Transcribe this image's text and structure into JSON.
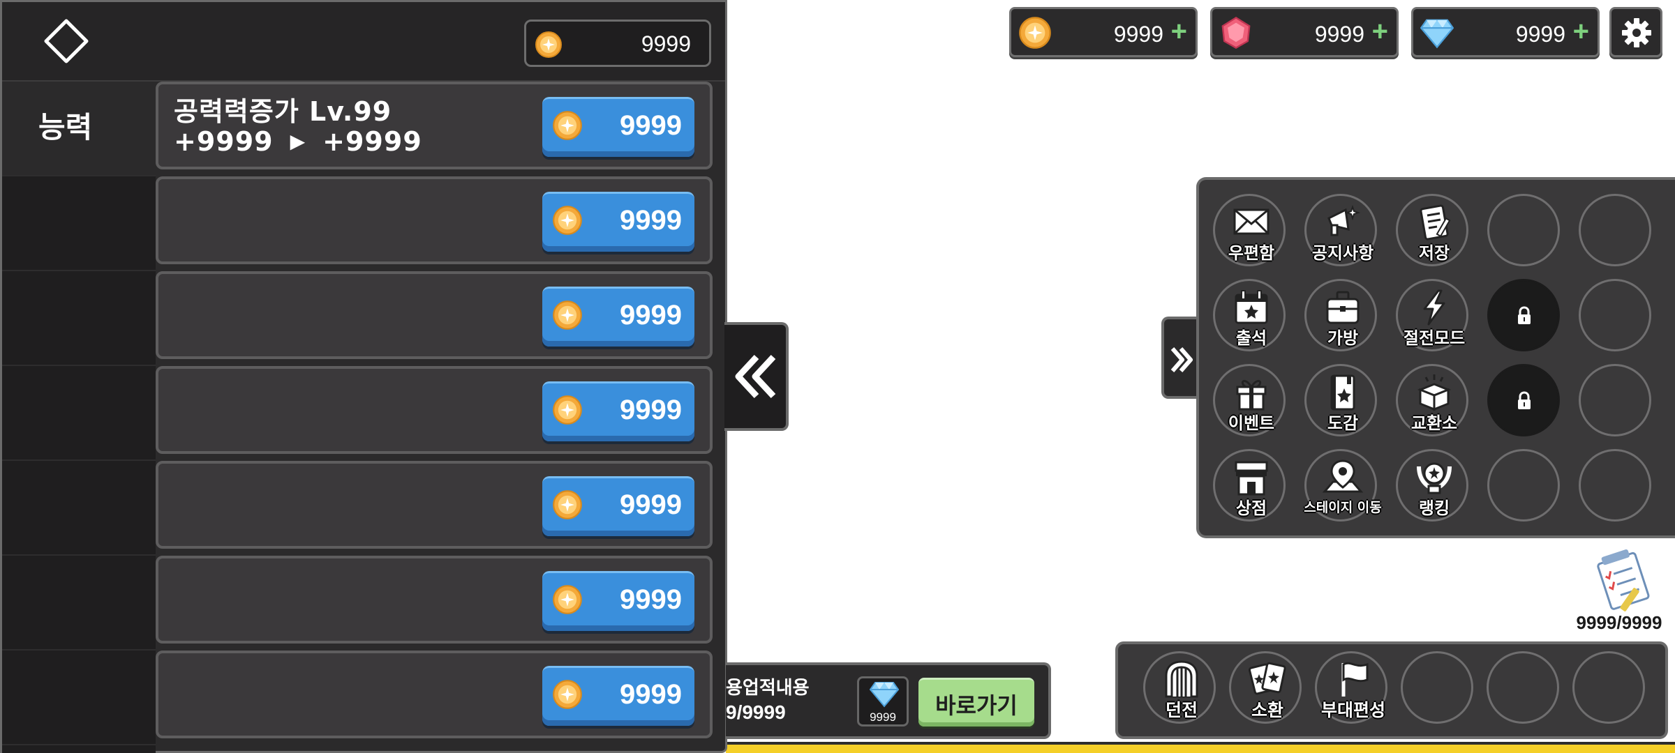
{
  "colors": {
    "panel_bg": "#2b2a2b",
    "upgrade_button": "#3a8fdc",
    "goto_button": "#a6dc8c",
    "plus_accent": "#7ed07e",
    "bottom_strip": "#f4cf28"
  },
  "left_panel": {
    "header_icon": "diamond-outline-icon",
    "gold": {
      "icon": "gold-coin-icon",
      "value": "9999"
    },
    "tabs": [
      {
        "label": "능력",
        "active": true
      },
      {
        "label": ""
      },
      {
        "label": ""
      },
      {
        "label": ""
      },
      {
        "label": ""
      },
      {
        "label": ""
      },
      {
        "label": ""
      }
    ],
    "rows": [
      {
        "title": "공력력증가 Lv.99",
        "stat_from": "+9999",
        "stat_to": "+9999",
        "cost": "9999"
      },
      {
        "title": "",
        "stat_from": "",
        "stat_to": "",
        "cost": "9999"
      },
      {
        "title": "",
        "stat_from": "",
        "stat_to": "",
        "cost": "9999"
      },
      {
        "title": "",
        "stat_from": "",
        "stat_to": "",
        "cost": "9999"
      },
      {
        "title": "",
        "stat_from": "",
        "stat_to": "",
        "cost": "9999"
      },
      {
        "title": "",
        "stat_from": "",
        "stat_to": "",
        "cost": "9999"
      },
      {
        "title": "",
        "stat_from": "",
        "stat_to": "",
        "cost": "9999"
      }
    ]
  },
  "quest": {
    "title": "용업적내용",
    "progress": "9/9999",
    "reward_icon": "diamond-gem-icon",
    "reward_value": "9999",
    "goto_label": "바로가기"
  },
  "currencies": [
    {
      "icon": "gold-coin-icon",
      "value": "9999",
      "plus": "+"
    },
    {
      "icon": "red-gem-icon",
      "value": "9999",
      "plus": "+"
    },
    {
      "icon": "diamond-gem-icon",
      "value": "9999",
      "plus": "+"
    }
  ],
  "settings_icon": "gear-icon",
  "menu_grid": [
    {
      "label": "우편함",
      "icon": "mail-icon"
    },
    {
      "label": "공지사항",
      "icon": "megaphone-icon"
    },
    {
      "label": "저장",
      "icon": "save-note-icon"
    },
    {
      "label": "",
      "icon": ""
    },
    {
      "label": "",
      "icon": ""
    },
    {
      "label": "출석",
      "icon": "calendar-star-icon"
    },
    {
      "label": "가방",
      "icon": "bag-icon"
    },
    {
      "label": "절전모드",
      "icon": "lightning-icon"
    },
    {
      "label": "",
      "icon": "lock-icon",
      "locked": true
    },
    {
      "label": "",
      "icon": ""
    },
    {
      "label": "이벤트",
      "icon": "gift-icon"
    },
    {
      "label": "도감",
      "icon": "book-star-icon"
    },
    {
      "label": "교환소",
      "icon": "exchange-box-icon"
    },
    {
      "label": "",
      "icon": "lock-icon",
      "locked": true
    },
    {
      "label": "",
      "icon": ""
    },
    {
      "label": "상점",
      "icon": "shop-icon"
    },
    {
      "label": "스테이지 이동",
      "icon": "map-pin-icon"
    },
    {
      "label": "랭킹",
      "icon": "ranking-badge-icon"
    },
    {
      "label": "",
      "icon": ""
    },
    {
      "label": "",
      "icon": ""
    }
  ],
  "task_counter": {
    "icon": "checklist-icon",
    "value": "9999/9999"
  },
  "bottom_menu": [
    {
      "label": "던전",
      "icon": "dungeon-gate-icon"
    },
    {
      "label": "소환",
      "icon": "summon-cards-icon"
    },
    {
      "label": "부대편성",
      "icon": "flag-icon"
    },
    {
      "label": "",
      "icon": ""
    },
    {
      "label": "",
      "icon": ""
    },
    {
      "label": "",
      "icon": ""
    }
  ]
}
